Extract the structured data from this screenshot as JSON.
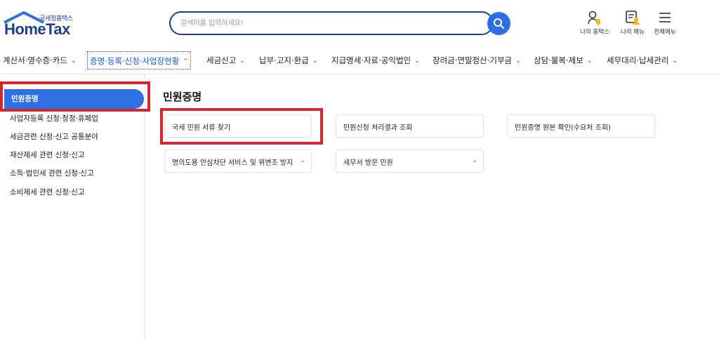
{
  "header": {
    "logo_sub": "국세청홈택스",
    "logo_main": "HomeTax",
    "search_placeholder": "검색어를 입력하세요!",
    "icons": [
      {
        "label": "나의 홈택스",
        "icon": "person-bell-icon"
      },
      {
        "label": "나의 메뉴",
        "icon": "menu-card-icon"
      },
      {
        "label": "전체메뉴",
        "icon": "hamburger-icon"
      }
    ]
  },
  "nav": {
    "items": [
      {
        "label": "계산서·영수증·카드"
      },
      {
        "label": "증명·등록·신청·사업장현황"
      },
      {
        "label": "세금신고"
      },
      {
        "label": "납부·고지·환급"
      },
      {
        "label": "지급명세·자료·공익법인"
      },
      {
        "label": "장려금·연말정산·기부금"
      },
      {
        "label": "상담·불복·제보"
      },
      {
        "label": "세무대리·납세관리"
      }
    ],
    "active_index": 1
  },
  "sidebar": {
    "active": "민원증명",
    "items": [
      "사업자등록 신청·정정·휴폐업",
      "세금관련 신청·신고 공통분야",
      "재산제세 관련 신청·신고",
      "소득·법인세 관련 신청·신고",
      "소비제세 관련 신청·신고"
    ]
  },
  "main": {
    "title": "민원증명",
    "cards": [
      {
        "label": "국세 민원 서류 찾기"
      },
      {
        "label": "민원신청 처리결과 조회"
      },
      {
        "label": "민원증명 원본 확인(수요처 조회)"
      },
      {
        "label": "명의도용 안심차단 서비스 및 위변조 방지"
      },
      {
        "label": "세무서 방문 민원"
      }
    ]
  },
  "colors": {
    "accent": "#2f6fe4",
    "brand": "#1f3f8e",
    "highlight": "#d6262b"
  }
}
